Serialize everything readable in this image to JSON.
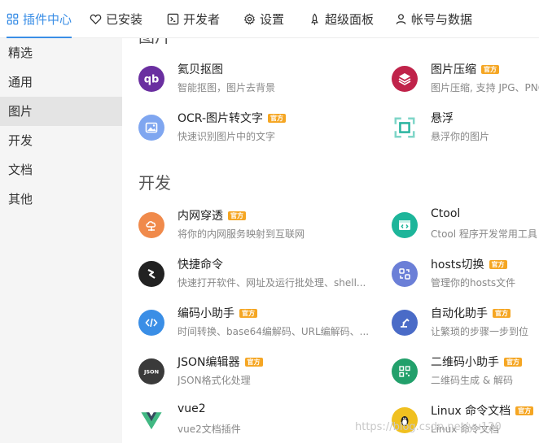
{
  "tabs": [
    {
      "label": "插件中心",
      "icon": "grid-icon"
    },
    {
      "label": "已安装",
      "icon": "heart-icon"
    },
    {
      "label": "开发者",
      "icon": "terminal-icon"
    },
    {
      "label": "设置",
      "icon": "gear-icon"
    },
    {
      "label": "超级面板",
      "icon": "rocket-icon"
    },
    {
      "label": "帐号与数据",
      "icon": "user-icon"
    }
  ],
  "sidebar": {
    "items": [
      {
        "label": "精选"
      },
      {
        "label": "通用"
      },
      {
        "label": "图片"
      },
      {
        "label": "开发"
      },
      {
        "label": "文档"
      },
      {
        "label": "其他"
      }
    ]
  },
  "sections": {
    "image_partial_title": "图片",
    "dev_title": "开发"
  },
  "badge_text": "官方",
  "image_plugins": [
    {
      "name": "氦贝抠图",
      "desc": "智能抠图，图片去背景",
      "official": false,
      "icon": "qb-logo-icon",
      "color": "#6a2fa0"
    },
    {
      "name": "图片压缩",
      "desc": "图片压缩, 支持 JPG、PNG",
      "official": true,
      "icon": "layers-icon",
      "color": "#c0234a"
    },
    {
      "name": "OCR-图片转文字",
      "desc": "快速识别图片中的文字",
      "official": true,
      "icon": "image-icon",
      "color": "#7fa6f0"
    },
    {
      "name": "悬浮",
      "desc": "悬浮你的图片",
      "official": false,
      "icon": "float-squares-icon",
      "color": "#2bb5a0"
    }
  ],
  "dev_plugins": [
    {
      "name": "内网穿透",
      "desc": "将你的内网服务映射到互联网",
      "official": true,
      "icon": "cloud-network-icon",
      "color": "#f08a4b"
    },
    {
      "name": "Ctool",
      "desc": "Ctool 程序开发常用工具",
      "official": false,
      "icon": "code-window-icon",
      "color": "#1db59a"
    },
    {
      "name": "快捷命令",
      "desc": "快速打开软件、网址及运行批处理、shell...",
      "official": false,
      "icon": "lightning-icon",
      "color": "#222222"
    },
    {
      "name": "hosts切换",
      "desc": "管理你的hosts文件",
      "official": true,
      "icon": "swap-icon",
      "color": "#6b7fd7"
    },
    {
      "name": "编码小助手",
      "desc": "时间转换、base64编解码、URL编解码、...",
      "official": true,
      "icon": "code-icon",
      "color": "#3a8ee6"
    },
    {
      "name": "自动化助手",
      "desc": "让繁琐的步骤一步到位",
      "official": true,
      "icon": "robot-arm-icon",
      "color": "#4a6bc7"
    },
    {
      "name": "JSON编辑器",
      "desc": "JSON格式化处理",
      "official": true,
      "icon": "json-icon",
      "color": "#3a3a3a"
    },
    {
      "name": "二维码小助手",
      "desc": "二维码生成 & 解码",
      "official": true,
      "icon": "qr-code-icon",
      "color": "#22a06b"
    },
    {
      "name": "vue2",
      "desc": "vue2文档插件",
      "official": false,
      "icon": "vue-logo-icon",
      "color": "#41b883"
    },
    {
      "name": "Linux 命令文档",
      "desc": "Linux 命令文档",
      "official": true,
      "icon": "penguin-icon",
      "color": "#f0c020"
    }
  ],
  "watermark": "https://blog.csdn.net/yu120"
}
